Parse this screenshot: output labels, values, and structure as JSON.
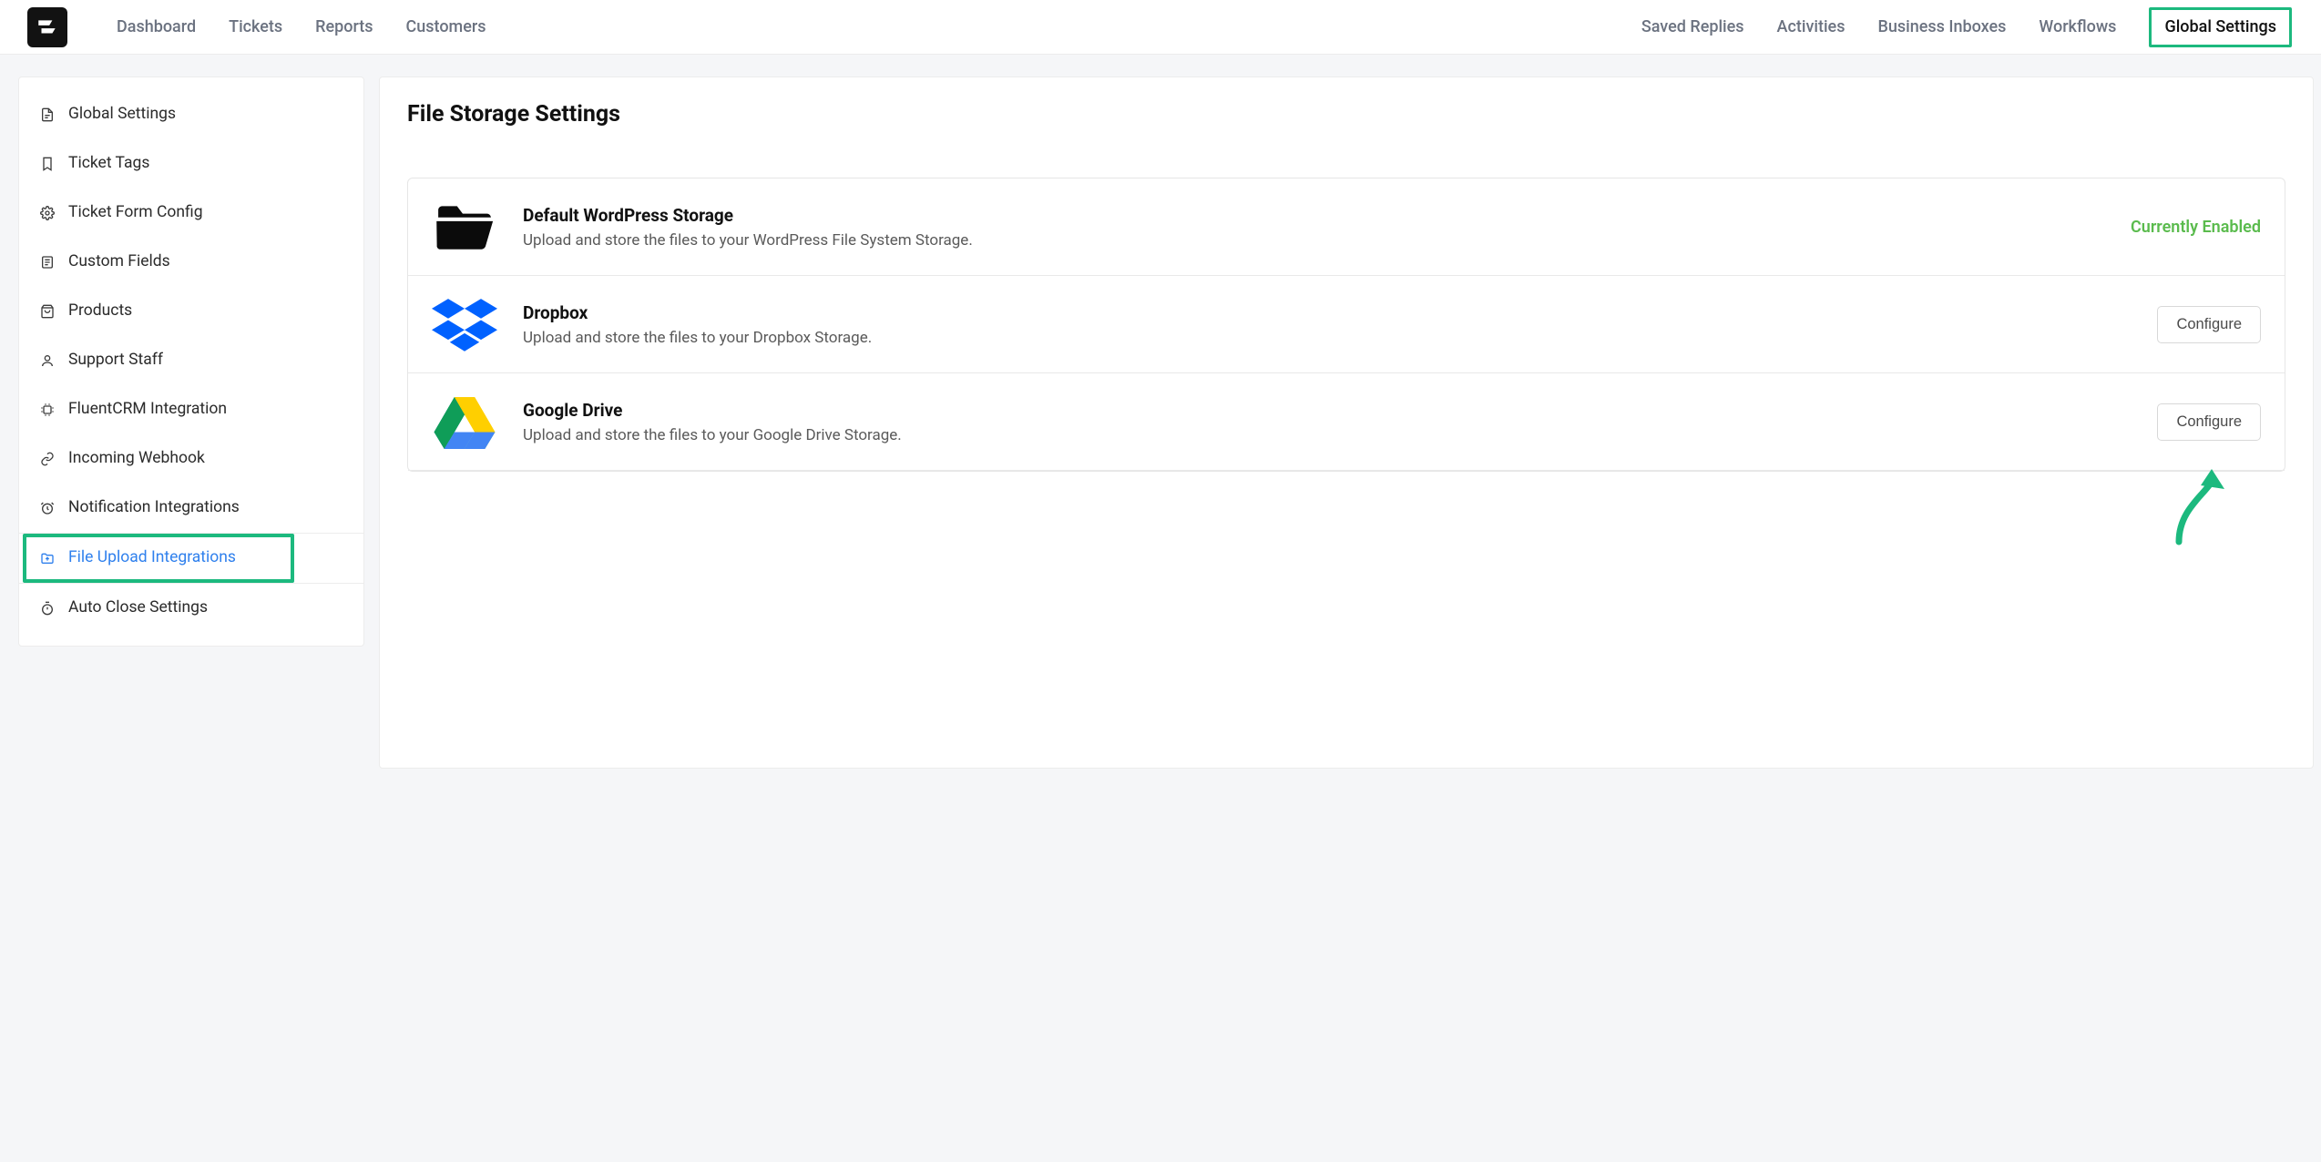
{
  "nav": {
    "left": [
      {
        "id": "dashboard",
        "label": "Dashboard"
      },
      {
        "id": "tickets",
        "label": "Tickets"
      },
      {
        "id": "reports",
        "label": "Reports"
      },
      {
        "id": "customers",
        "label": "Customers"
      }
    ],
    "right": [
      {
        "id": "saved-replies",
        "label": "Saved Replies"
      },
      {
        "id": "activities",
        "label": "Activities"
      },
      {
        "id": "business-inboxes",
        "label": "Business Inboxes"
      },
      {
        "id": "workflows",
        "label": "Workflows"
      },
      {
        "id": "global-settings",
        "label": "Global Settings",
        "active": true
      }
    ]
  },
  "sidebar": [
    {
      "id": "global-settings",
      "label": "Global Settings",
      "icon": "doc"
    },
    {
      "id": "ticket-tags",
      "label": "Ticket Tags",
      "icon": "bookmark"
    },
    {
      "id": "ticket-form-config",
      "label": "Ticket Form Config",
      "icon": "gear"
    },
    {
      "id": "custom-fields",
      "label": "Custom Fields",
      "icon": "list"
    },
    {
      "id": "products",
      "label": "Products",
      "icon": "bag"
    },
    {
      "id": "support-staff",
      "label": "Support Staff",
      "icon": "user"
    },
    {
      "id": "fluentcrm-integration",
      "label": "FluentCRM Integration",
      "icon": "chip"
    },
    {
      "id": "incoming-webhook",
      "label": "Incoming Webhook",
      "icon": "link"
    },
    {
      "id": "notification-integrations",
      "label": "Notification Integrations",
      "icon": "clock"
    },
    {
      "id": "file-upload-integrations",
      "label": "File Upload Integrations",
      "icon": "upload",
      "selected": true,
      "highlight": true
    },
    {
      "id": "auto-close-settings",
      "label": "Auto Close Settings",
      "icon": "timer"
    }
  ],
  "main": {
    "title": "File Storage Settings",
    "rows": [
      {
        "id": "wordpress",
        "icon": "folder",
        "title": "Default WordPress Storage",
        "desc": "Upload and store the files to your WordPress File System Storage.",
        "status": "Currently Enabled"
      },
      {
        "id": "dropbox",
        "icon": "dropbox",
        "title": "Dropbox",
        "desc": "Upload and store the files to your Dropbox Storage.",
        "button": "Configure"
      },
      {
        "id": "google-drive",
        "icon": "gdrive",
        "title": "Google Drive",
        "desc": "Upload and store the files to your Google Drive Storage.",
        "button": "Configure"
      }
    ]
  }
}
